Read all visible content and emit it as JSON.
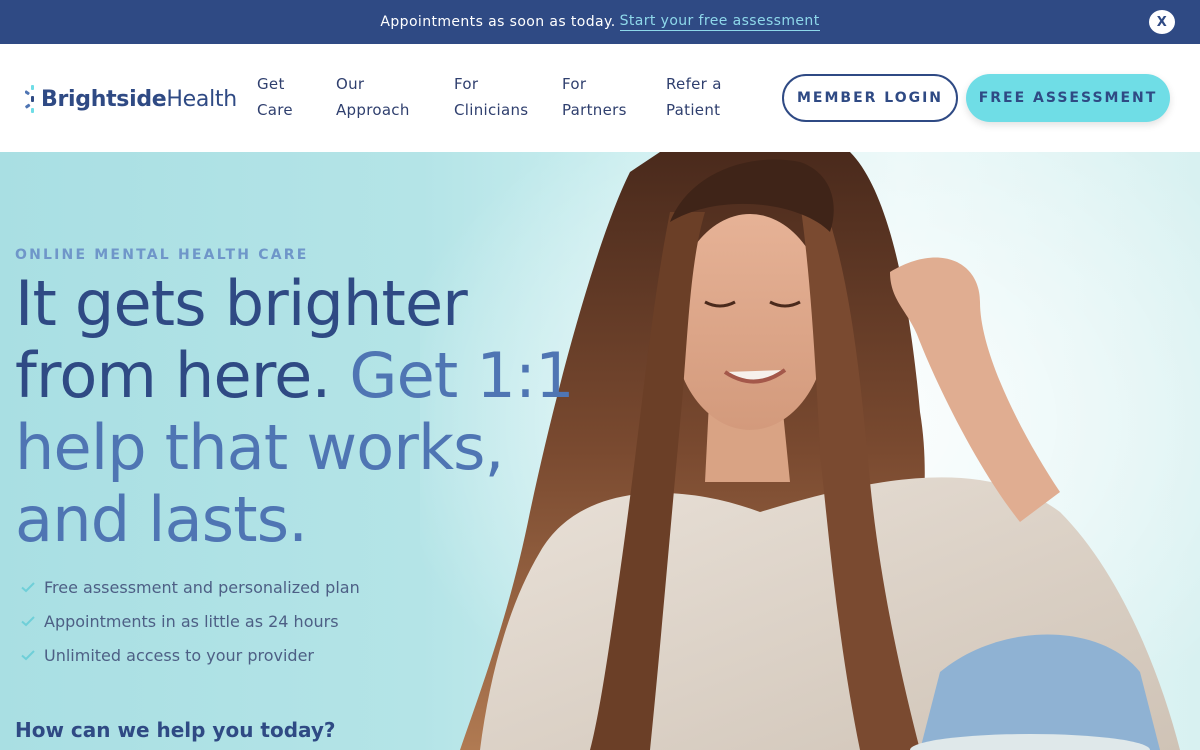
{
  "announcement": {
    "message": "Appointments as soon as today.",
    "link": "Start your free assessment",
    "close": "X"
  },
  "header": {
    "logo": {
      "bold": "Brightside",
      "light": "Health"
    },
    "nav": [
      {
        "line1": "Get",
        "line2": "Care"
      },
      {
        "line1": "Our",
        "line2": "Approach"
      },
      {
        "line1": "For",
        "line2": "Clinicians"
      },
      {
        "line1": "For",
        "line2": "Partners"
      },
      {
        "line1": "Refer a",
        "line2": "Patient"
      }
    ],
    "login_label": "MEMBER LOGIN",
    "assessment_label": "FREE ASSESSMENT"
  },
  "hero": {
    "eyebrow": "ONLINE MENTAL HEALTH CARE",
    "headline_main": "It gets brighter from here.",
    "headline_accent": "Get 1:1 help that works, and lasts.",
    "benefits": [
      "Free assessment and personalized plan",
      "Appointments in as little as 24 hours",
      "Unlimited access to your provider"
    ],
    "help_prompt": "How can we help you today?"
  },
  "colors": {
    "navy": "#2f4a84",
    "accent_blue": "#4f75b3",
    "teal": "#6fdde6",
    "hero_bg": "#b4e4e7"
  },
  "icons": [
    "logo-spark-icon",
    "close-icon",
    "check-icon"
  ]
}
